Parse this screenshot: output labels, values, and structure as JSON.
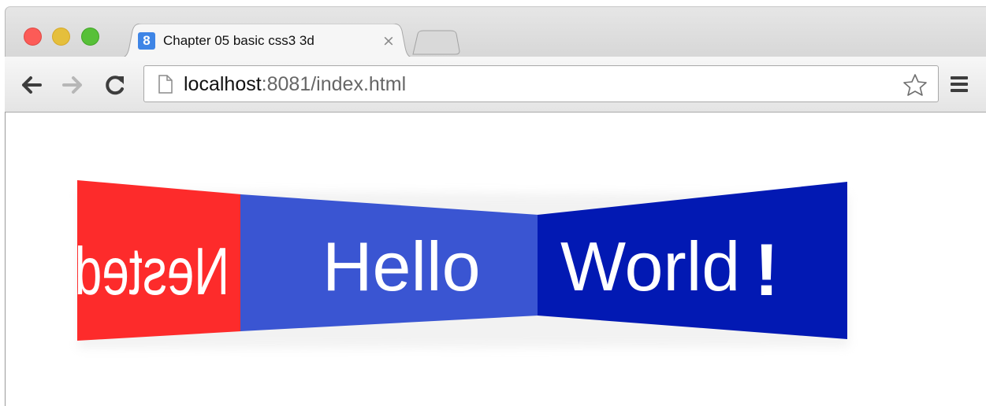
{
  "browser": {
    "tab": {
      "favicon_letter": "8",
      "title": "Chapter 05 basic css3 3d",
      "close_glyph": "×"
    },
    "address_bar": {
      "host": "localhost",
      "rest": ":8081/index.html"
    }
  },
  "page": {
    "panels": [
      {
        "text": "Nested",
        "color": "#fd2b2b",
        "mirrored": true
      },
      {
        "text": "Hello",
        "color": "#3a55d2",
        "mirrored": false
      },
      {
        "text": "World",
        "color": "#0219b3",
        "mirrored": false
      }
    ],
    "exclamation": "!",
    "text_color": "#ffffff"
  }
}
